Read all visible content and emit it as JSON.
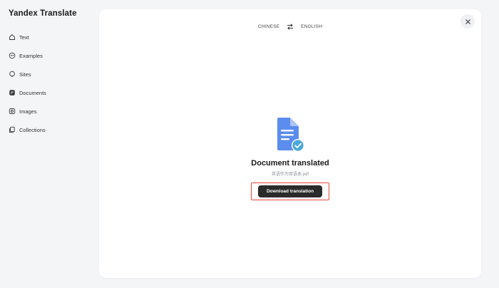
{
  "app": {
    "title": "Yandex Translate"
  },
  "sidebar": {
    "items": [
      {
        "label": "Text",
        "icon": "translate-icon"
      },
      {
        "label": "Examples",
        "icon": "quote-icon"
      },
      {
        "label": "Sites",
        "icon": "globe-icon"
      },
      {
        "label": "Documents",
        "icon": "document-icon",
        "active": true
      },
      {
        "label": "Images",
        "icon": "image-icon"
      },
      {
        "label": "Collections",
        "icon": "collections-icon"
      }
    ]
  },
  "lang_bar": {
    "source": "CHINESE",
    "target": "ENGLISH"
  },
  "result": {
    "title": "Document translated",
    "filename": "英语作为双语本.pdf",
    "download_label": "Download translation"
  },
  "colors": {
    "accent_blue": "#5b8def",
    "check_teal": "#4aa8d8",
    "button_dark": "#2b2b2b",
    "highlight_red": "#e8483a"
  }
}
